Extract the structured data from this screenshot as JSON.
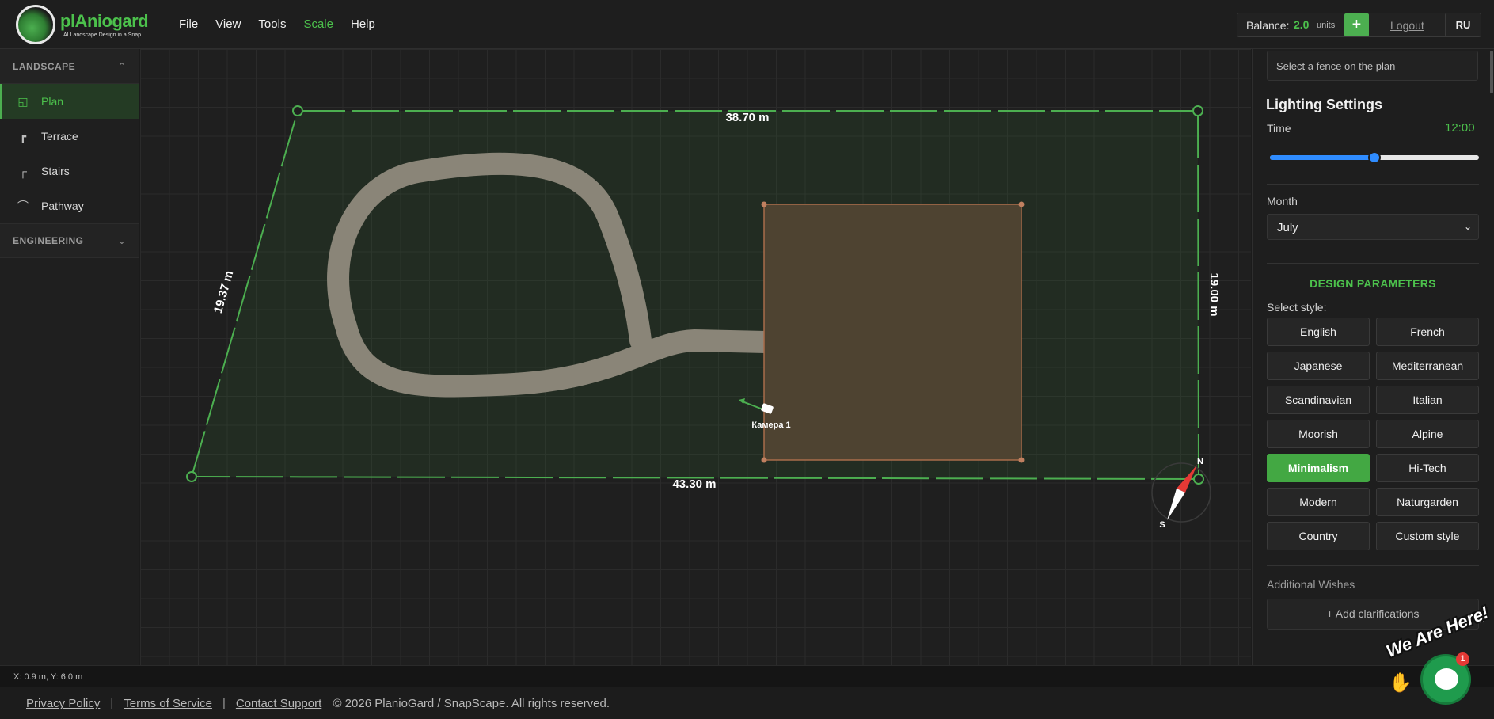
{
  "app": {
    "logo_text": "plAniogard",
    "logo_sub": "AI Landscape Design in a Snap"
  },
  "menu": [
    {
      "label": "File",
      "active": false
    },
    {
      "label": "View",
      "active": false
    },
    {
      "label": "Tools",
      "active": false
    },
    {
      "label": "Scale",
      "active": true
    },
    {
      "label": "Help",
      "active": false
    }
  ],
  "account": {
    "balance_label": "Balance:",
    "balance_value": "2.0",
    "balance_unit": "units",
    "add_label": "+",
    "logout_label": "Logout",
    "language": "RU"
  },
  "sidebar": {
    "landscape_header": "LANDSCAPE",
    "items": [
      {
        "label": "Plan",
        "icon": "plan-icon",
        "active": true
      },
      {
        "label": "Terrace",
        "icon": "terrace-icon",
        "active": false
      },
      {
        "label": "Stairs",
        "icon": "stairs-icon",
        "active": false
      },
      {
        "label": "Pathway",
        "icon": "pathway-icon",
        "active": false
      }
    ],
    "engineering_header": "ENGINEERING"
  },
  "plan": {
    "dim_top": "38.70 m",
    "dim_left": "19.37 m",
    "dim_right": "19.00 m",
    "dim_bottom": "43.30 m",
    "camera_label": "Камера 1",
    "compass_n": "N",
    "compass_s": "S"
  },
  "panel": {
    "fence_placeholder": "Select a fence on the plan",
    "lighting_title": "Lighting Settings",
    "time_label": "Time",
    "time_value": "12:00",
    "time_fraction": 0.5,
    "month_label": "Month",
    "month_value": "July",
    "design_params_title": "DESIGN PARAMETERS",
    "select_style_label": "Select style:",
    "styles": [
      {
        "label": "English",
        "active": false
      },
      {
        "label": "French",
        "active": false
      },
      {
        "label": "Japanese",
        "active": false
      },
      {
        "label": "Mediterranean",
        "active": false
      },
      {
        "label": "Scandinavian",
        "active": false
      },
      {
        "label": "Italian",
        "active": false
      },
      {
        "label": "Moorish",
        "active": false
      },
      {
        "label": "Alpine",
        "active": false
      },
      {
        "label": "Minimalism",
        "active": true
      },
      {
        "label": "Hi-Tech",
        "active": false
      },
      {
        "label": "Modern",
        "active": false
      },
      {
        "label": "Naturgarden",
        "active": false
      },
      {
        "label": "Country",
        "active": false
      },
      {
        "label": "Custom style",
        "active": false
      }
    ],
    "additional_wishes_label": "Additional Wishes",
    "add_clarifications_label": "+ Add clarifications"
  },
  "status": {
    "coords": "X: 0.9 m, Y: 6.0 m"
  },
  "footer": {
    "privacy": "Privacy Policy",
    "terms": "Terms of Service",
    "contact": "Contact Support",
    "copyright": "© 2026 PlanioGard / SnapScape. All rights reserved.",
    "separator": "|"
  },
  "chat": {
    "banner": "We Are Here!",
    "badge": "1",
    "close": "×"
  },
  "colors": {
    "accent": "#4cc14c",
    "fence": "#4caf50",
    "house": "#5a4a36",
    "path": "#8a8578"
  }
}
